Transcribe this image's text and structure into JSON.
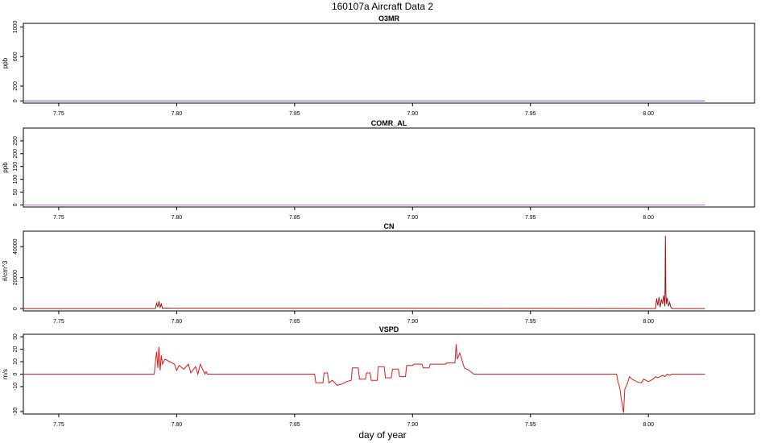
{
  "title": "160107a   Aircraft Data 2",
  "xlabel": "day of year",
  "chart_data": [
    {
      "type": "line",
      "title": "O3MR",
      "ylabel": "ppb",
      "xlim": [
        7.735,
        8.045
      ],
      "ylim": [
        -30,
        1050
      ],
      "xticks": [
        "7.75",
        "7.80",
        "7.85",
        "7.90",
        "7.95",
        "8.00"
      ],
      "yticks": [
        "0",
        "200",
        "600",
        "1000"
      ],
      "series": [
        {
          "color": "#6b4ce0",
          "x": [
            7.735,
            8.024
          ],
          "y": [
            0,
            0
          ]
        }
      ]
    },
    {
      "type": "line",
      "title": "COMR_AL",
      "ylabel": "ppb",
      "xlim": [
        7.735,
        8.045
      ],
      "ylim": [
        -8,
        300
      ],
      "xticks": [
        "7.75",
        "7.80",
        "7.85",
        "7.90",
        "7.95",
        "8.00"
      ],
      "yticks": [
        "0",
        "50",
        "100",
        "150",
        "200",
        "250"
      ],
      "series": [
        {
          "color": "#c874e6",
          "x": [
            7.735,
            8.024
          ],
          "y": [
            0,
            0
          ]
        }
      ]
    },
    {
      "type": "line",
      "title": "CN",
      "ylabel": "#/cm^3",
      "xlim": [
        7.735,
        8.045
      ],
      "ylim": [
        -1500,
        50000
      ],
      "xticks": [
        "7.75",
        "7.80",
        "7.85",
        "7.90",
        "7.95",
        "8.00"
      ],
      "yticks": [
        "0",
        "20000",
        "40000"
      ],
      "series": [
        {
          "color": "#a31515",
          "x": [
            7.735,
            7.791,
            7.7915,
            7.792,
            7.7925,
            7.793,
            7.7935,
            7.794,
            7.795,
            7.8,
            7.85,
            7.9,
            7.95,
            8.003,
            8.0035,
            8.004,
            8.0045,
            8.005,
            8.0055,
            8.006,
            8.0065,
            8.007,
            8.0072,
            8.0074,
            8.0076,
            8.008,
            8.0085,
            8.009,
            8.0095,
            8.01,
            8.024
          ],
          "y": [
            0,
            0,
            3500,
            1000,
            4800,
            800,
            3000,
            0,
            300,
            200,
            150,
            150,
            100,
            0,
            6500,
            2000,
            7500,
            1000,
            6000,
            3000,
            8500,
            1500,
            47000,
            10000,
            3000,
            7000,
            1500,
            4000,
            800,
            0,
            0
          ]
        }
      ]
    },
    {
      "type": "line",
      "title": "VSPD",
      "ylabel": "m/s",
      "xlim": [
        7.735,
        8.045
      ],
      "ylim": [
        -32,
        32
      ],
      "xticks": [
        "7.75",
        "7.80",
        "7.85",
        "7.90",
        "7.95",
        "8.00"
      ],
      "yticks": [
        "-30",
        "-10",
        "0",
        "10",
        "20",
        "30"
      ],
      "series": [
        {
          "color": "#e11b1b",
          "x": [
            7.735,
            7.7905,
            7.791,
            7.7915,
            7.792,
            7.7925,
            7.793,
            7.7935,
            7.794,
            7.795,
            7.797,
            7.799,
            7.8,
            7.801,
            7.803,
            7.805,
            7.806,
            7.808,
            7.809,
            7.81,
            7.812,
            7.8125,
            7.813,
            7.815,
            7.83,
            7.845,
            7.8585,
            7.859,
            7.862,
            7.8625,
            7.864,
            7.8645,
            7.866,
            7.868,
            7.87,
            7.872,
            7.874,
            7.8745,
            7.877,
            7.8775,
            7.88,
            7.8805,
            7.882,
            7.8825,
            7.885,
            7.8855,
            7.888,
            7.8885,
            7.891,
            7.8915,
            7.894,
            7.8945,
            7.897,
            7.8975,
            7.9,
            7.9005,
            7.904,
            7.9045,
            7.907,
            7.9075,
            7.914,
            7.9145,
            7.918,
            7.9185,
            7.919,
            7.92,
            7.922,
            7.924,
            7.926,
            7.94,
            7.96,
            7.975,
            7.9865,
            7.987,
            7.988,
            7.9885,
            7.9895,
            7.99,
            7.991,
            7.992,
            7.993,
            7.995,
            7.997,
            7.998,
            8.0,
            8.002,
            8.003,
            8.004,
            8.006,
            8.007,
            8.008,
            8.009,
            8.01,
            8.024
          ],
          "y": [
            0,
            0,
            10,
            18,
            5,
            22,
            3,
            15,
            8,
            12,
            10,
            8,
            3,
            7,
            4,
            8,
            1,
            6,
            0,
            8,
            0,
            2,
            0,
            0,
            0,
            0,
            0,
            -7,
            -7,
            1,
            1,
            -7,
            -5,
            -9,
            -8,
            -6,
            -5,
            5,
            5,
            -4,
            -4,
            1,
            1,
            -5,
            -5,
            6,
            6,
            -3,
            -3,
            4,
            4,
            -2,
            -2,
            7,
            7,
            8,
            8,
            5,
            5,
            8,
            8,
            9,
            9,
            24,
            12,
            17,
            5,
            3,
            0,
            0,
            0,
            0,
            0,
            -5,
            -12,
            -20,
            -31,
            -12,
            -8,
            -2,
            -4,
            -6,
            -7,
            -4,
            -6,
            -4,
            -2,
            -3,
            -1,
            -2,
            0,
            -1,
            0,
            0
          ]
        }
      ]
    }
  ]
}
